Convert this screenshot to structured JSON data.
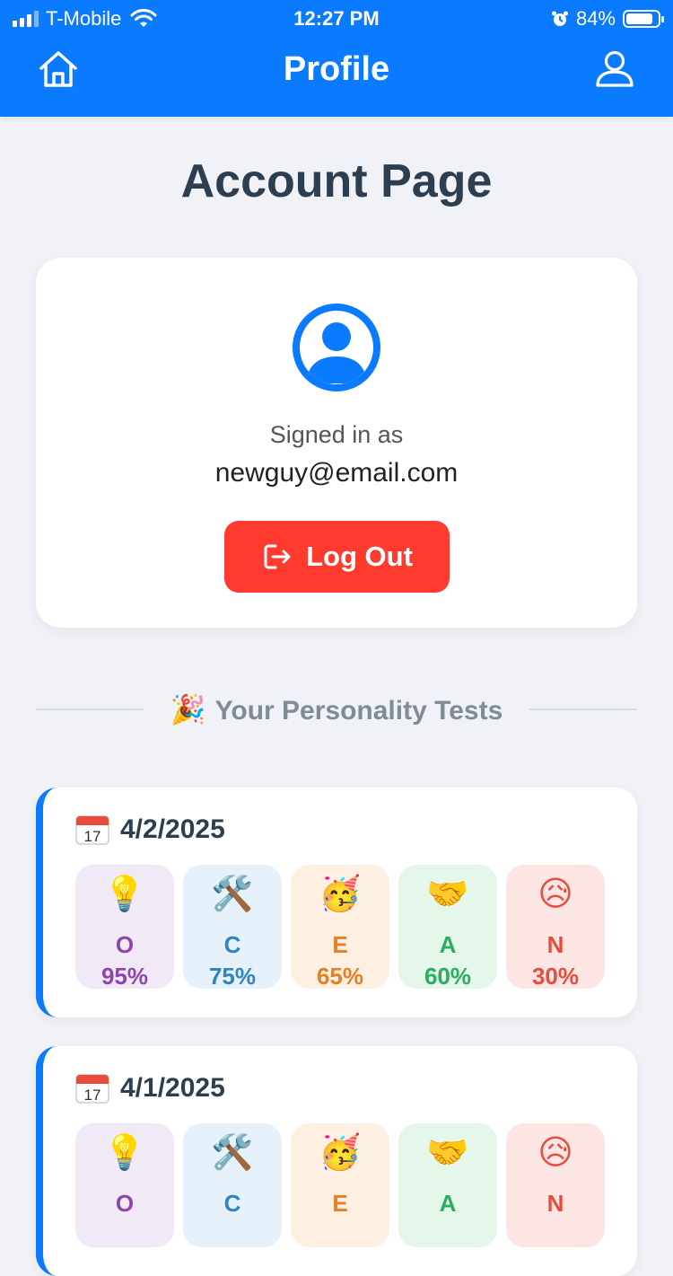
{
  "status_bar": {
    "carrier": "T-Mobile",
    "time": "12:27 PM",
    "battery": "84%",
    "battery_level": 0.84
  },
  "nav": {
    "title": "Profile",
    "left_icon": "home-icon",
    "right_icon": "user-icon"
  },
  "page": {
    "title": "Account Page"
  },
  "account": {
    "signed_in_label": "Signed in as",
    "email": "newguy@email.com",
    "logout_label": "Log Out"
  },
  "section": {
    "emoji": "🎉",
    "label": "Your Personality Tests"
  },
  "tests": [
    {
      "date": "4/2/2025",
      "traits": [
        {
          "emoji": "💡",
          "letter": "O",
          "value": "95%",
          "color": "#8e44ad",
          "bg": "#f2e9f6"
        },
        {
          "emoji": "🛠️",
          "letter": "C",
          "value": "75%",
          "color": "#2e86c1",
          "bg": "#e6f1fa"
        },
        {
          "emoji": "🥳",
          "letter": "E",
          "value": "65%",
          "color": "#e67e22",
          "bg": "#fdf0e2"
        },
        {
          "emoji": "🤝",
          "letter": "A",
          "value": "60%",
          "color": "#27ae60",
          "bg": "#e5f6ea"
        },
        {
          "emoji": "😥",
          "letter": "N",
          "value": "30%",
          "color": "#e74c3c",
          "bg": "#fbe6e4"
        }
      ]
    },
    {
      "date": "4/1/2025",
      "traits": [
        {
          "emoji": "💡",
          "letter": "O",
          "value": "",
          "color": "#8e44ad",
          "bg": "#f2e9f6"
        },
        {
          "emoji": "🛠️",
          "letter": "C",
          "value": "",
          "color": "#2e86c1",
          "bg": "#e6f1fa"
        },
        {
          "emoji": "🥳",
          "letter": "E",
          "value": "",
          "color": "#e67e22",
          "bg": "#fdf0e2"
        },
        {
          "emoji": "🤝",
          "letter": "A",
          "value": "",
          "color": "#27ae60",
          "bg": "#e5f6ea"
        },
        {
          "emoji": "😥",
          "letter": "N",
          "value": "",
          "color": "#e74c3c",
          "bg": "#fbe6e4"
        }
      ]
    }
  ],
  "colors": {
    "primary": "#0a7bff",
    "danger": "#ff3b30",
    "background": "#f0f2f7"
  }
}
